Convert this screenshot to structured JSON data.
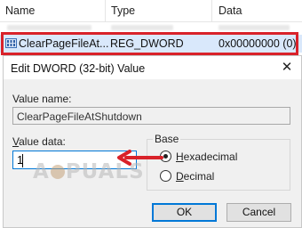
{
  "columns": {
    "name": "Name",
    "type": "Type",
    "data": "Data"
  },
  "selected_row": {
    "name": "ClearPageFileAt...",
    "type": "REG_DWORD",
    "data": "0x00000000 (0)",
    "icon": "registry-binary-value-icon"
  },
  "dialog": {
    "title": "Edit DWORD (32-bit) Value",
    "value_name_label": "Value name:",
    "value_name": "ClearPageFileAtShutdown",
    "value_data_label": "Value data:",
    "value_data": "1",
    "base": {
      "label": "Base",
      "options": [
        "Hexadecimal",
        "Decimal"
      ],
      "selected": "Hexadecimal"
    },
    "ok_label": "OK",
    "cancel_label": "Cancel"
  },
  "watermark": "A PUALS",
  "colors": {
    "highlight": "#d9222a",
    "arrow": "#d9222a",
    "focus": "#0078d7",
    "selection": "#d9e8fb"
  }
}
